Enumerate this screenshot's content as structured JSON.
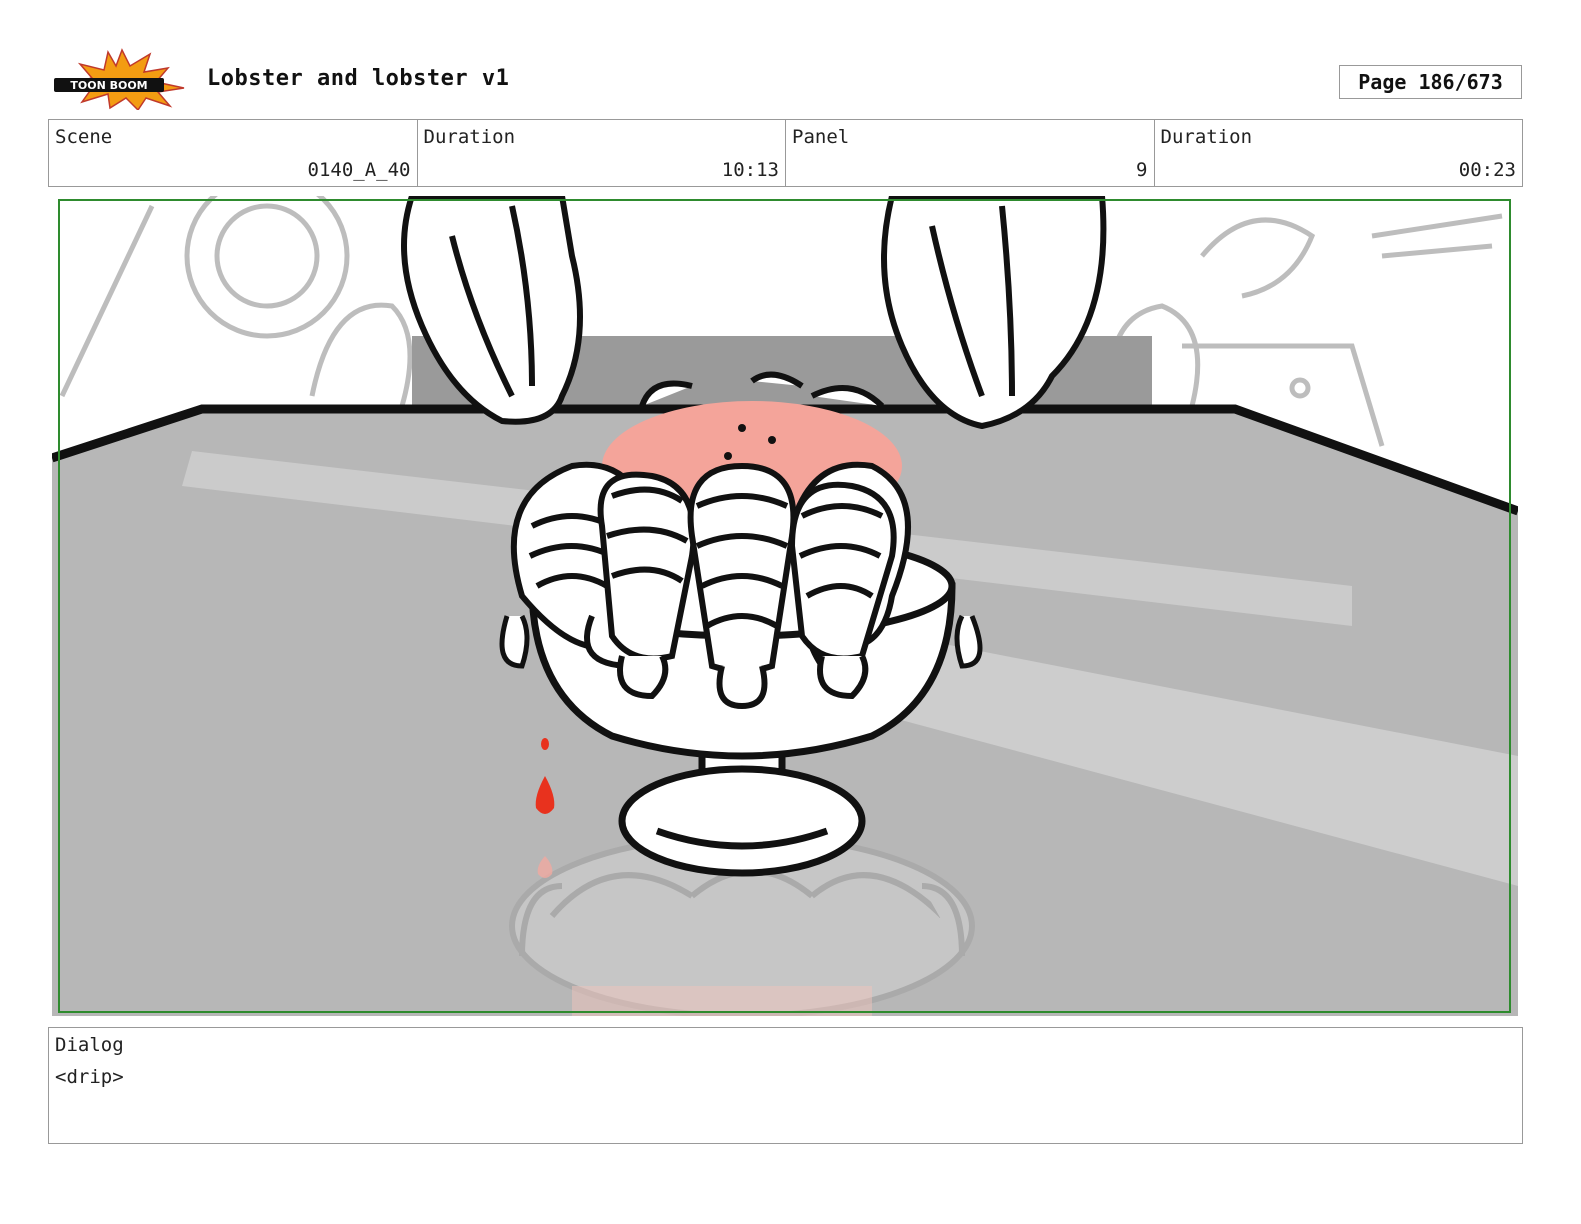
{
  "header": {
    "logo_text": "TOON BOOM",
    "title": "Lobster and lobster v1",
    "page": "Page 186/673"
  },
  "info": {
    "scene_label": "Scene",
    "scene_value": "0140_A_40",
    "scene_duration_label": "Duration",
    "scene_duration_value": "10:13",
    "panel_label": "Panel",
    "panel_value": "9",
    "panel_duration_label": "Duration",
    "panel_duration_value": "00:23"
  },
  "panel_image": {
    "icon": "storyboard-drawing-shrimp-cocktail-bowl",
    "colors": {
      "frame": "#2e8b2e",
      "sauce": "#f4a49a",
      "drip": "#e8321e",
      "counter": "#b5b5b5"
    }
  },
  "dialog": {
    "label": "Dialog",
    "text": "<drip>"
  }
}
